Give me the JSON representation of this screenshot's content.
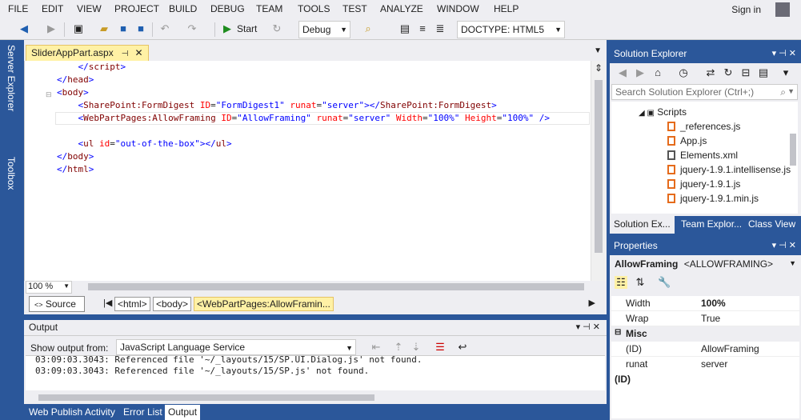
{
  "menu": [
    "FILE",
    "EDIT",
    "VIEW",
    "PROJECT",
    "BUILD",
    "DEBUG",
    "TEAM",
    "TOOLS",
    "TEST",
    "ANALYZE",
    "WINDOW",
    "HELP"
  ],
  "signin": "Sign in",
  "toolbar": {
    "start_label": "Start",
    "config_value": "Debug",
    "doctype_value": "DOCTYPE: HTML5"
  },
  "side_tabs": [
    "Server Explorer",
    "Toolbox"
  ],
  "editor": {
    "tab_title": "SliderAppPart.aspx",
    "zoom": "100 %",
    "source_label": "Source",
    "breadcrumb": [
      "<html>",
      "<body>",
      "<WebPartPages:AllowFramin..."
    ]
  },
  "output": {
    "title": "Output",
    "show_from_label": "Show output from:",
    "source_value": "JavaScript Language Service",
    "lines": [
      "03:09:03.3043: Referenced file '~/_layouts/15/SP.UI.Dialog.js' not found.",
      "03:09:03.3043: Referenced file '~/_layouts/15/SP.js' not found."
    ]
  },
  "bottom_tabs": [
    "Web Publish Activity",
    "Error List",
    "Output"
  ],
  "solution_explorer": {
    "title": "Solution Explorer",
    "search_placeholder": "Search Solution Explorer (Ctrl+;)",
    "items": [
      "Scripts",
      "_references.js",
      "App.js",
      "Elements.xml",
      "jquery-1.9.1.intellisense.js",
      "jquery-1.9.1.js",
      "jquery-1.9.1.min.js"
    ],
    "tabs": [
      "Solution Ex...",
      "Team Explor...",
      "Class View"
    ]
  },
  "properties": {
    "title": "Properties",
    "object_name": "AllowFraming",
    "object_type": "<ALLOWFRAMING>",
    "rows": [
      {
        "key": "Width",
        "value": "100%"
      },
      {
        "key": "Wrap",
        "value": "True"
      }
    ],
    "category": "Misc",
    "misc_rows": [
      {
        "key": "(ID)",
        "value": "AllowFraming"
      },
      {
        "key": "runat",
        "value": "server"
      }
    ],
    "description": "(ID)"
  }
}
